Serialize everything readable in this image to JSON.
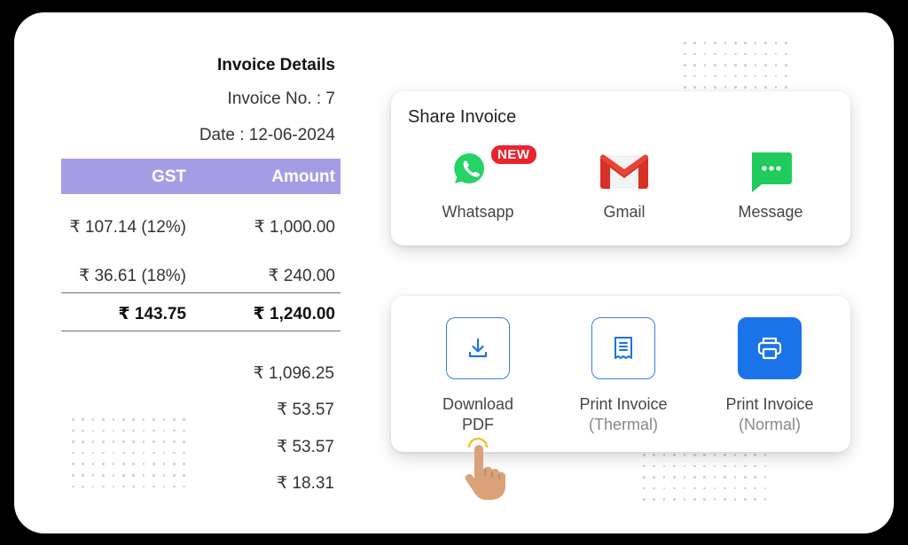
{
  "invoice": {
    "title": "Invoice Details",
    "number_line": "Invoice No. : 7",
    "date_line": "Date : 12-06-2024"
  },
  "table": {
    "headers": {
      "gst": "GST",
      "amount": "Amount"
    },
    "rows": [
      {
        "gst": "₹ 107.14 (12%)",
        "amount": "₹ 1,000.00"
      },
      {
        "gst": "₹ 36.61 (18%)",
        "amount": "₹ 240.00"
      }
    ],
    "total": {
      "gst": "₹ 143.75",
      "amount": "₹ 1,240.00"
    },
    "header_color": "#a49de6"
  },
  "summary_amounts": [
    "₹ 1,096.25",
    "₹ 53.57",
    "₹ 53.57",
    "₹ 18.31"
  ],
  "share": {
    "title": "Share Invoice",
    "options": [
      {
        "label": "Whatsapp",
        "icon": "whatsapp-icon",
        "badge": "NEW"
      },
      {
        "label": "Gmail",
        "icon": "gmail-icon"
      },
      {
        "label": "Message",
        "icon": "message-icon"
      }
    ]
  },
  "print": {
    "options": [
      {
        "line1": "Download",
        "line2": "PDF",
        "icon": "download-icon"
      },
      {
        "line1": "Print Invoice",
        "line2": "(Thermal)",
        "icon": "receipt-icon"
      },
      {
        "line1": "Print Invoice",
        "line2": "(Normal)",
        "icon": "printer-icon"
      }
    ],
    "accent_color": "#1a73e8"
  },
  "pointer": {
    "icon": "tap-hand-icon"
  }
}
